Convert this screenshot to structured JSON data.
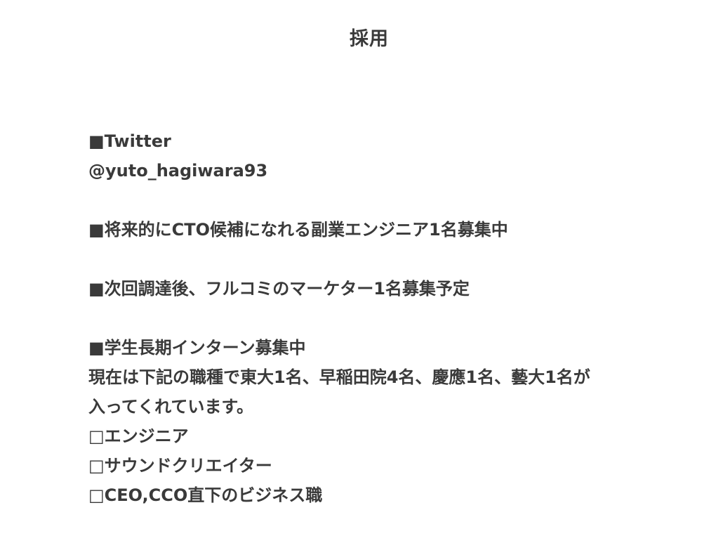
{
  "page": {
    "title": "採用"
  },
  "twitter": {
    "heading": "■Twitter",
    "handle": "@yuto_hagiwara93"
  },
  "sections": {
    "cto": "■将来的にCTO候補になれる副業エンジニア1名募集中",
    "marketer": "■次回調達後、フルコミのマーケター1名募集予定",
    "intern": {
      "heading": "■学生長期インターン募集中",
      "description_line1": "現在は下記の職種で東大1名、早稲田院4名、慶應1名、藝大1名が",
      "description_line2": "入ってくれています。",
      "roles": [
        "□エンジニア",
        "□サウンドクリエイター",
        "□CEO,CCO直下のビジネス職"
      ]
    }
  }
}
